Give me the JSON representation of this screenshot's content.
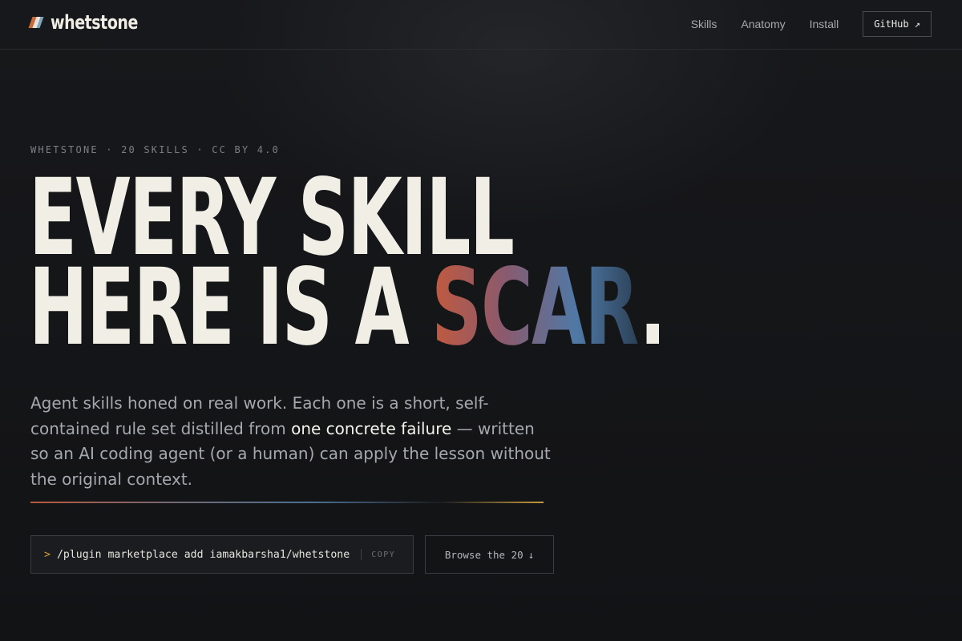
{
  "header": {
    "brand": "whetstone",
    "nav": [
      "Skills",
      "Anatomy",
      "Install"
    ],
    "github_label": "GitHub ↗"
  },
  "hero": {
    "eyebrow": "WHETSTONE · 20 SKILLS · CC BY 4.0",
    "headline_line1": "EVERY SKILL",
    "headline_line2_lead": "HERE IS A ",
    "headline_line2_accent": "SCAR",
    "headline_line2_tail": ".",
    "lede_part1": "Agent skills honed on real work. Each one is a short, self-contained rule set distilled from ",
    "lede_emphasis": "one concrete failure",
    "lede_part2": " — written so an AI coding agent (or a human) can apply the lesson without the original context."
  },
  "install": {
    "prompt": ">",
    "command": "/plugin marketplace add iamakbarsha1/whetstone",
    "copy_label": "COPY",
    "browse_label": "Browse the 20",
    "browse_icon": "↓"
  },
  "colors": {
    "accent_orange": "#c25a3e",
    "accent_blue": "#4f79a6",
    "prompt": "#d49a3a",
    "background": "#131416"
  }
}
